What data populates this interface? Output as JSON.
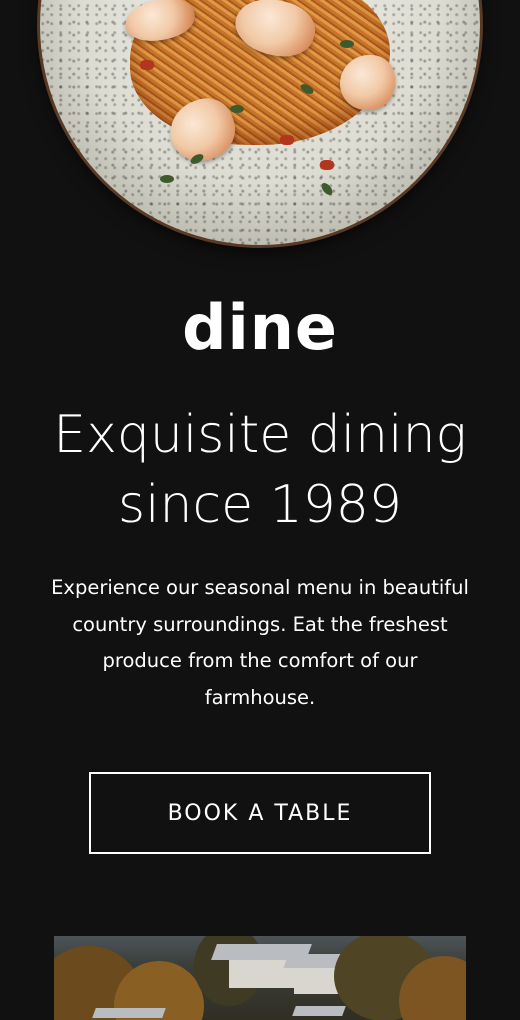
{
  "hero": {
    "image_alt": "Plate of shrimp pasta"
  },
  "brand": {
    "logo_text": "dine"
  },
  "headline": {
    "line1": "Exquisite dining",
    "line2": "since 1989"
  },
  "description": {
    "text": "Experience our seasonal menu in beautiful country surroundings. Eat the freshest produce from the comfort of our farmhouse."
  },
  "cta": {
    "label": "BOOK A TABLE"
  },
  "farm": {
    "image_alt": "Farmhouse surrounded by autumn trees"
  },
  "colors": {
    "background": "#111111",
    "text": "#ffffff",
    "button_border": "#ffffff"
  }
}
